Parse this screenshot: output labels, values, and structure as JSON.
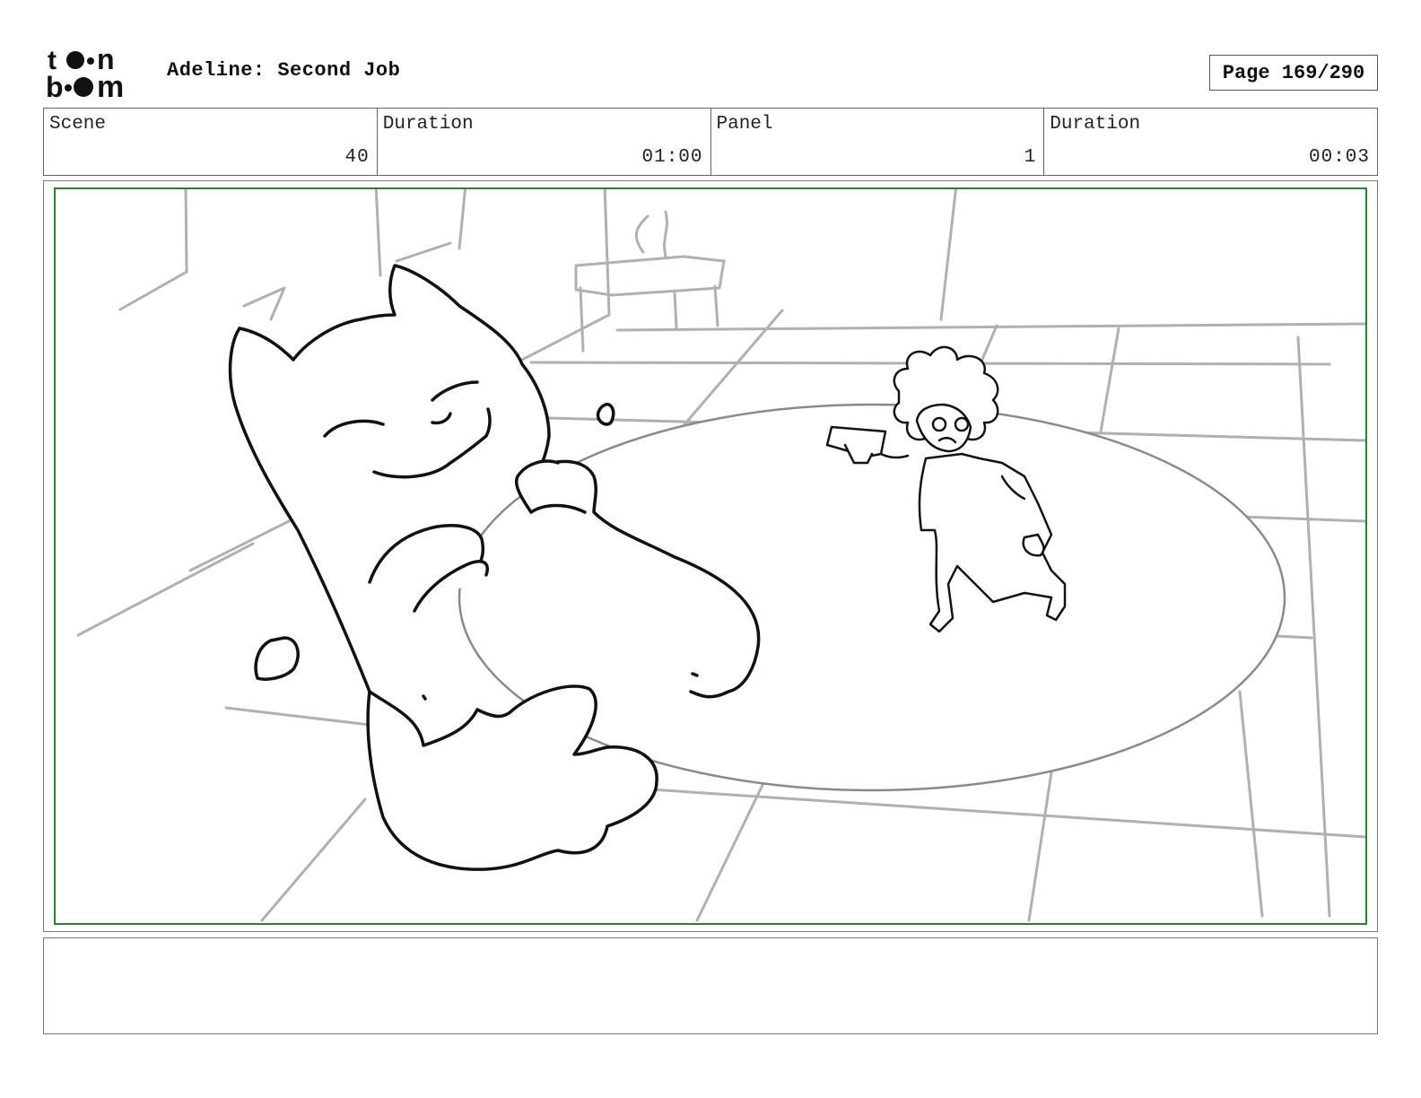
{
  "header": {
    "logo_alt": "toon boom",
    "project_title": "Adeline: Second Job",
    "page_label": "Page 169/290"
  },
  "info": {
    "scene_label": "Scene",
    "scene_value": "40",
    "scene_duration_label": "Duration",
    "scene_duration_value": "01:00",
    "panel_label": "Panel",
    "panel_value": "1",
    "panel_duration_label": "Duration",
    "panel_duration_value": "00:03"
  },
  "panel": {
    "frame_color": "#2e7d32"
  },
  "notes": {
    "text": ""
  }
}
